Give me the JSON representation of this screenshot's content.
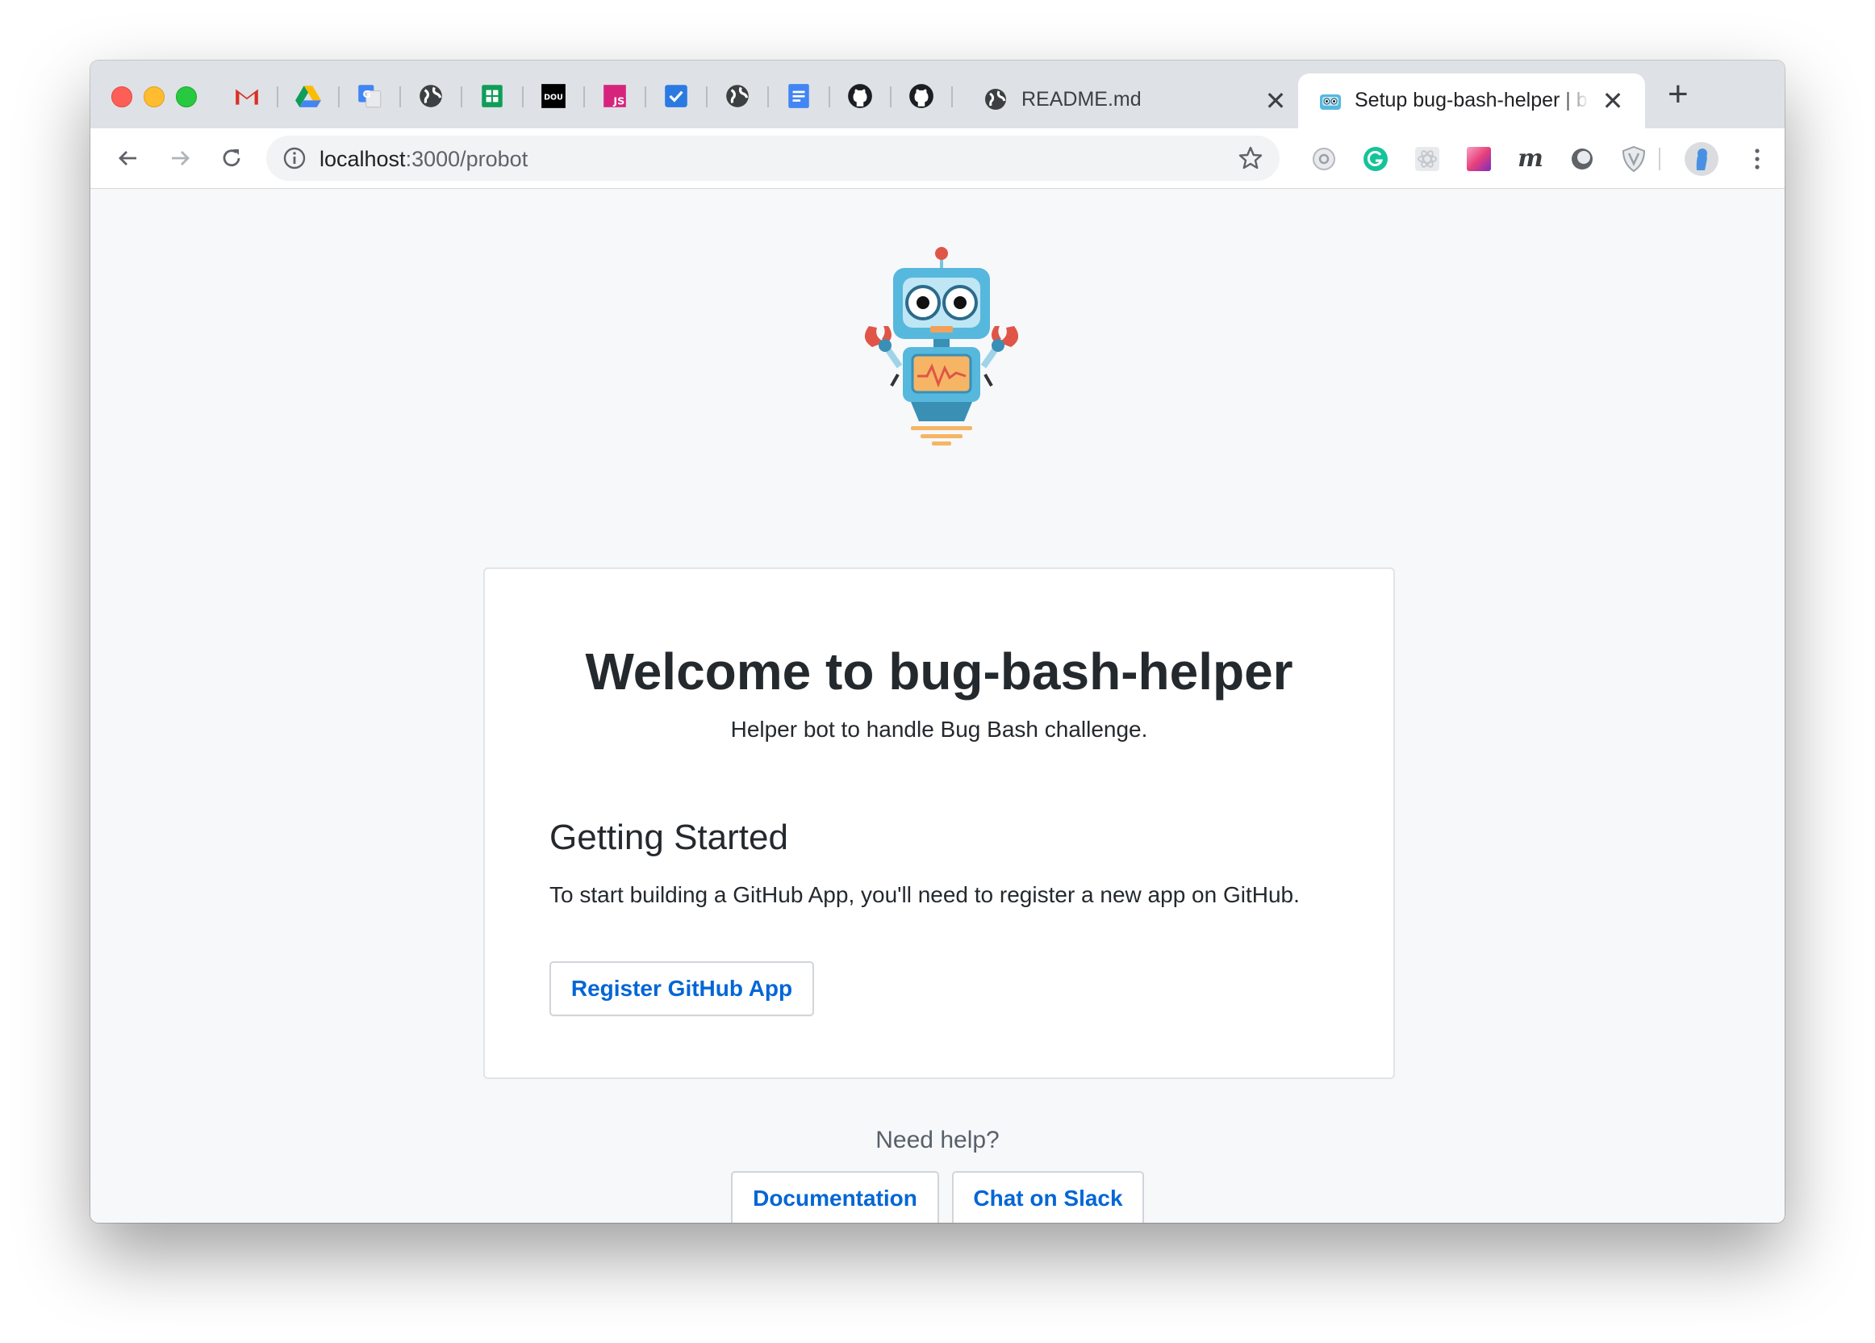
{
  "tabs": {
    "pinned_icons": [
      "gmail-icon",
      "google-drive-icon",
      "google-translate-icon",
      "globe-icon",
      "google-sheets-icon",
      "dou-icon",
      "javascript-icon",
      "tasks-icon",
      "globe-icon",
      "google-docs-icon",
      "github-icon",
      "github-icon"
    ],
    "dou_label": "DOU",
    "js_label": "JS",
    "readme_title": "README.md",
    "active_title": "Setup bug-bash-helper | bug-bash-helper",
    "close_glyph": "✕",
    "new_tab_glyph": "+"
  },
  "toolbar": {
    "url_host": "localhost",
    "url_path": ":3000/probot",
    "extensions": [
      "settings-ext-icon",
      "grammarly-icon",
      "react-devtools-icon",
      "color-picker-icon",
      "m-extension-icon",
      "circle-extension-icon",
      "shield-extension-icon"
    ],
    "m_label": "m"
  },
  "page": {
    "title": "Welcome to bug-bash-helper",
    "subtitle": "Helper bot to handle Bug Bash challenge.",
    "section_heading": "Getting Started",
    "section_text": "To start building a GitHub App, you'll need to register a new app on GitHub.",
    "register_button": "Register GitHub App",
    "help_text": "Need help?",
    "docs_button": "Documentation",
    "slack_button": "Chat on Slack"
  },
  "colors": {
    "link_blue": "#0366d6",
    "heading": "#24292e",
    "tab_strip": "#dee1e6",
    "page_bg": "#f7f8fa"
  }
}
